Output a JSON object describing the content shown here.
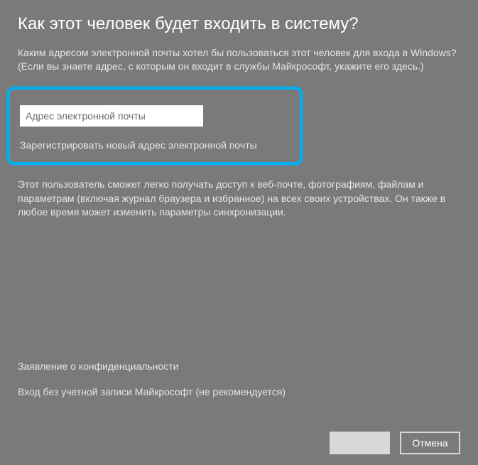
{
  "title": "Как этот человек будет входить в систему?",
  "intro": "Каким адресом электронной почты хотел бы пользоваться этот человек для входа в Windows? (Если вы знаете адрес, с которым он входит в службы Майкрософт, укажите его здесь.)",
  "email": {
    "placeholder": "Адрес электронной почты",
    "register_link": "Зарегистрировать новый адрес электронной почты"
  },
  "description": "Этот пользователь сможет легко получать доступ к веб-почте, фотографиям, файлам и параметрам (включая журнал браузера и избранное) на всех своих устройствах. Он также в любое время может изменить параметры синхронизации.",
  "links": {
    "privacy": "Заявление о конфиденциальности",
    "no_account": "Вход без учетной записи Майкрософт (не рекомендуется)"
  },
  "buttons": {
    "primary": "",
    "cancel": "Отмена"
  }
}
